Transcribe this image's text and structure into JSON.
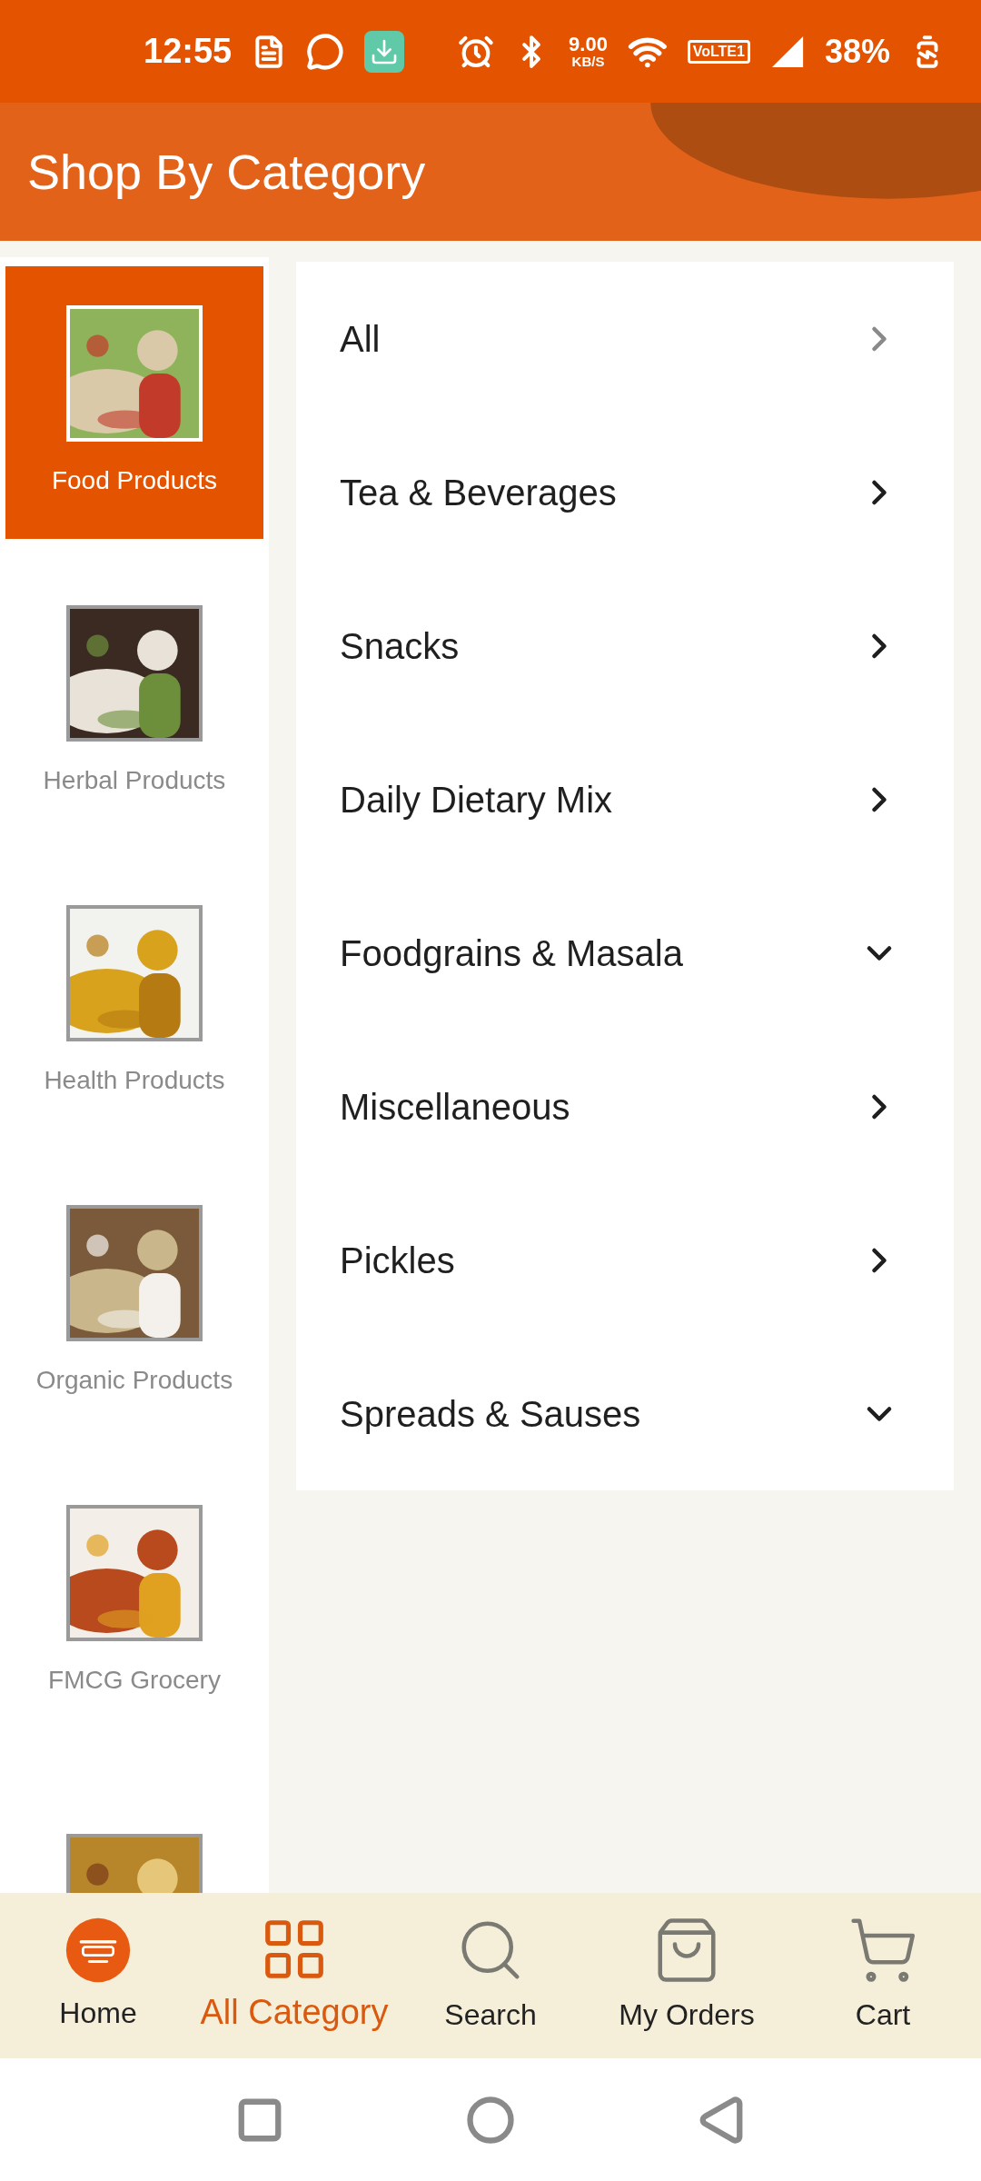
{
  "status_bar": {
    "time": "12:55",
    "speed": "9.00",
    "speed_unit": "KB/S",
    "network": "VoLTE1",
    "battery": "38%"
  },
  "header": {
    "title": "Shop By Category"
  },
  "sidebar": {
    "items": [
      {
        "label": "Food Products",
        "selected": true
      },
      {
        "label": "Herbal Products",
        "selected": false
      },
      {
        "label": "Health Products",
        "selected": false
      },
      {
        "label": "Organic Products",
        "selected": false
      },
      {
        "label": "FMCG Grocery",
        "selected": false
      },
      {
        "selected": false
      }
    ]
  },
  "categories": [
    {
      "label": "All",
      "kind": "link",
      "dimmed": true
    },
    {
      "label": "Tea & Beverages",
      "kind": "link",
      "dimmed": false
    },
    {
      "label": "Snacks",
      "kind": "link",
      "dimmed": false
    },
    {
      "label": "Daily Dietary Mix",
      "kind": "link",
      "dimmed": false
    },
    {
      "label": "Foodgrains & Masala",
      "kind": "group",
      "dimmed": false
    },
    {
      "label": "Miscellaneous",
      "kind": "link",
      "dimmed": false
    },
    {
      "label": "Pickles",
      "kind": "link",
      "dimmed": false
    },
    {
      "label": "Spreads & Sauses",
      "kind": "group",
      "dimmed": false
    }
  ],
  "bottom_nav": [
    {
      "label": "Home",
      "kind": "logo",
      "selected": false
    },
    {
      "label": "All Category",
      "kind": "grid",
      "selected": true
    },
    {
      "label": "Search",
      "kind": "search",
      "selected": false
    },
    {
      "label": "My Orders",
      "kind": "bag",
      "selected": false
    },
    {
      "label": "Cart",
      "kind": "cart",
      "selected": false
    }
  ]
}
